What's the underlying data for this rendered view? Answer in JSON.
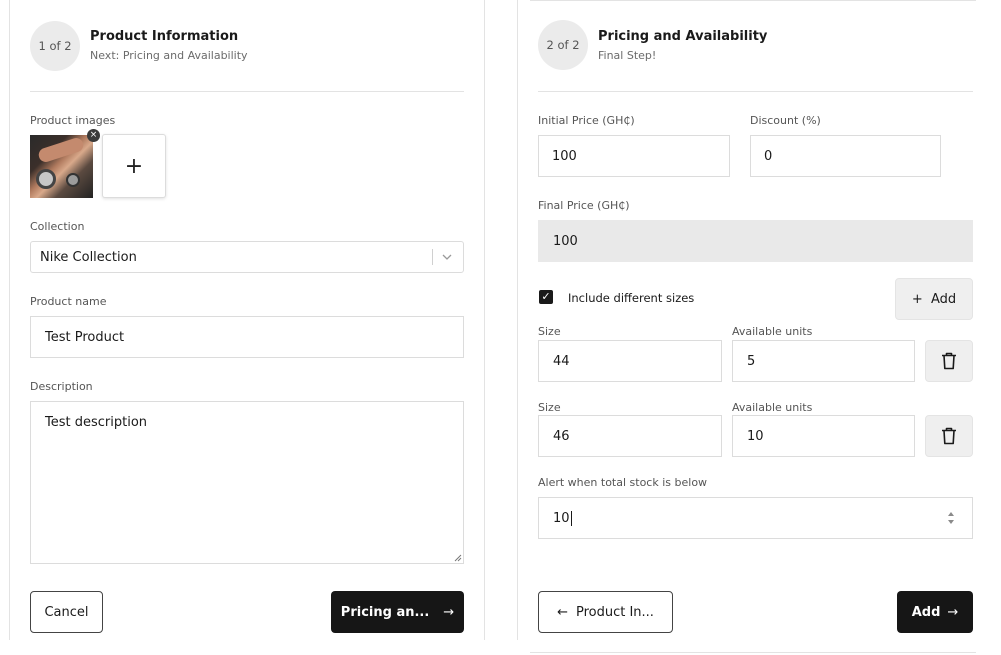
{
  "left": {
    "step": "1 of 2",
    "title": "Product Information",
    "subtitle": "Next: Pricing and Availability",
    "images_label": "Product images",
    "thumb_remove": "×",
    "add_image": "+",
    "collection_label": "Collection",
    "collection_value": "Nike Collection",
    "name_label": "Product name",
    "name_value": "Test Product",
    "description_label": "Description",
    "description_value": "Test description",
    "cancel_label": "Cancel",
    "next_label": "Pricing an...",
    "next_arrow": "→"
  },
  "right": {
    "step": "2 of 2",
    "title": "Pricing and Availability",
    "subtitle": "Final Step!",
    "initial_price_label": "Initial Price (GH₵)",
    "initial_price_value": "100",
    "discount_label": "Discount (%)",
    "discount_value": "0",
    "final_price_label": "Final Price (GH₵)",
    "final_price_value": "100",
    "sizes_checkbox_label": "Include different sizes",
    "sizes_checked": true,
    "checkmark": "✓",
    "add_size_label": "+  Add",
    "sizes": [
      {
        "size_label": "Size",
        "size_value": "44",
        "units_label": "Available units",
        "units_value": "5"
      },
      {
        "size_label": "Size",
        "size_value": "46",
        "units_label": "Available units",
        "units_value": "10"
      }
    ],
    "alert_label": "Alert when total stock is below",
    "alert_value": "10",
    "back_arrow": "←",
    "back_label": "Product In...",
    "submit_label": "Add",
    "submit_arrow": "→"
  }
}
